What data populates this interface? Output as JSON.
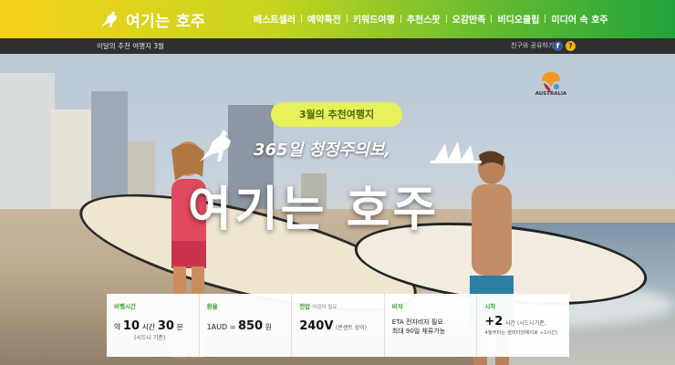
{
  "brand": {
    "logo_text": "여기는 호주",
    "accent_colors": {
      "yellow": "#f5d21c",
      "green": "#21a33a",
      "pill": "#e8f05a"
    }
  },
  "nav": {
    "items": [
      {
        "label": "베스트셀러"
      },
      {
        "label": "예약특전"
      },
      {
        "label": "키워드여행"
      },
      {
        "label": "추천스팟"
      },
      {
        "label": "오감만족"
      },
      {
        "label": "비디오클립"
      },
      {
        "label": "미디어 속 호주"
      }
    ]
  },
  "subbar": {
    "title": "이달의 추천 여행지 3월",
    "share_label": "친구와 공유하기",
    "facebook_icon": "f",
    "share_icon": "?"
  },
  "hero": {
    "pill": "3월의 추천여행지",
    "slogan": "365일 청정주의보,",
    "headline": "여기는 호주",
    "partner_logo_text": "AUSTRALIA"
  },
  "info": {
    "flight": {
      "label": "비행시간",
      "prefix": "약",
      "hours": "10",
      "hours_unit": "시간",
      "minutes": "30",
      "minutes_unit": "분",
      "note": "(시드니 기준)"
    },
    "exchange": {
      "label": "환율",
      "from": "1AUD =",
      "value": "850",
      "unit": "원"
    },
    "voltage": {
      "label": "전압",
      "label_note": "어댑터 필요",
      "value": "240V",
      "note": "(콘센트 상이)"
    },
    "visa": {
      "label": "비자",
      "line1": "ETA 전자비자 필요",
      "line2": "최대 90일 체류가능"
    },
    "time": {
      "label": "시차",
      "value": "+2",
      "note1": "시간 (시드니기준,",
      "note2": "4월부터는 썸머타임해지로 +1시간)"
    }
  }
}
